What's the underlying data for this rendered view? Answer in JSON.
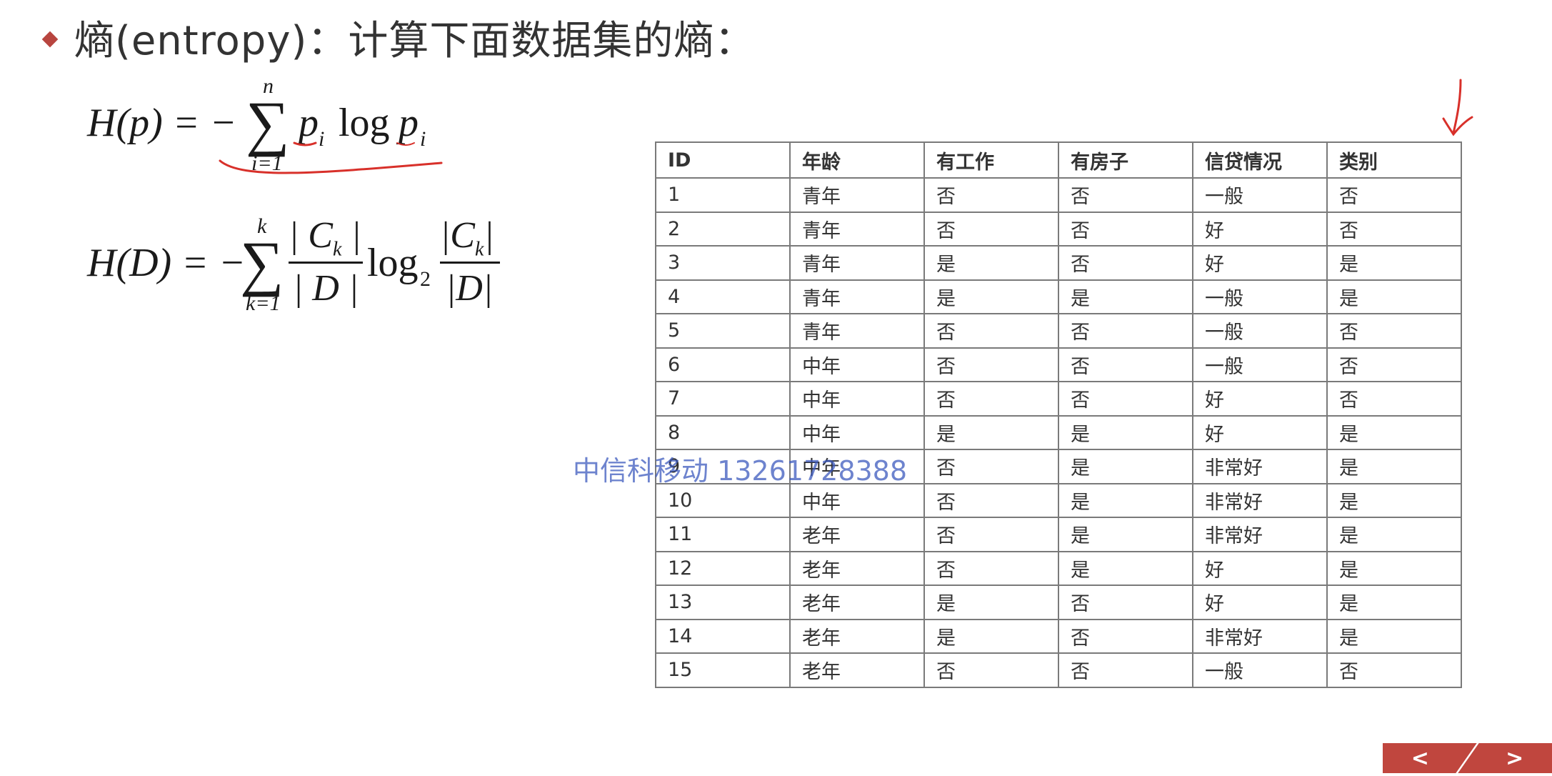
{
  "title": "熵(entropy)：计算下面数据集的熵：",
  "formula1": {
    "lhs": "H(p) = −",
    "sum_upper": "n",
    "sum_lower": "i=1",
    "term_p": "p",
    "term_i": "i",
    "log": "log",
    "term_p2": "p",
    "term_i2": "i"
  },
  "formula2": {
    "lhs": "H(D) = −",
    "sum_upper": "k",
    "sum_lower": "k=1",
    "frac1_num": "| C",
    "frac1_num_sub": "k",
    "frac1_num_end": " |",
    "frac1_den": "| D |",
    "log": "log",
    "log_base": "2",
    "frac2_num": "|C",
    "frac2_num_sub": "k",
    "frac2_num_end": "|",
    "frac2_den": "|D|"
  },
  "table": {
    "headers": [
      "ID",
      "年龄",
      "有工作",
      "有房子",
      "信贷情况",
      "类别"
    ],
    "rows": [
      [
        "1",
        "青年",
        "否",
        "否",
        "一般",
        "否"
      ],
      [
        "2",
        "青年",
        "否",
        "否",
        "好",
        "否"
      ],
      [
        "3",
        "青年",
        "是",
        "否",
        "好",
        "是"
      ],
      [
        "4",
        "青年",
        "是",
        "是",
        "一般",
        "是"
      ],
      [
        "5",
        "青年",
        "否",
        "否",
        "一般",
        "否"
      ],
      [
        "6",
        "中年",
        "否",
        "否",
        "一般",
        "否"
      ],
      [
        "7",
        "中年",
        "否",
        "否",
        "好",
        "否"
      ],
      [
        "8",
        "中年",
        "是",
        "是",
        "好",
        "是"
      ],
      [
        "9",
        "中年",
        "否",
        "是",
        "非常好",
        "是"
      ],
      [
        "10",
        "中年",
        "否",
        "是",
        "非常好",
        "是"
      ],
      [
        "11",
        "老年",
        "否",
        "是",
        "非常好",
        "是"
      ],
      [
        "12",
        "老年",
        "否",
        "是",
        "好",
        "是"
      ],
      [
        "13",
        "老年",
        "是",
        "否",
        "好",
        "是"
      ],
      [
        "14",
        "老年",
        "是",
        "否",
        "非常好",
        "是"
      ],
      [
        "15",
        "老年",
        "否",
        "否",
        "一般",
        "否"
      ]
    ]
  },
  "watermark": "中信科移动 13261728388",
  "nav": {
    "prev": "<",
    "next": ">"
  },
  "colors": {
    "accent": "#c0463e",
    "annotation": "#d8302a",
    "watermark": "#3c5abe"
  }
}
